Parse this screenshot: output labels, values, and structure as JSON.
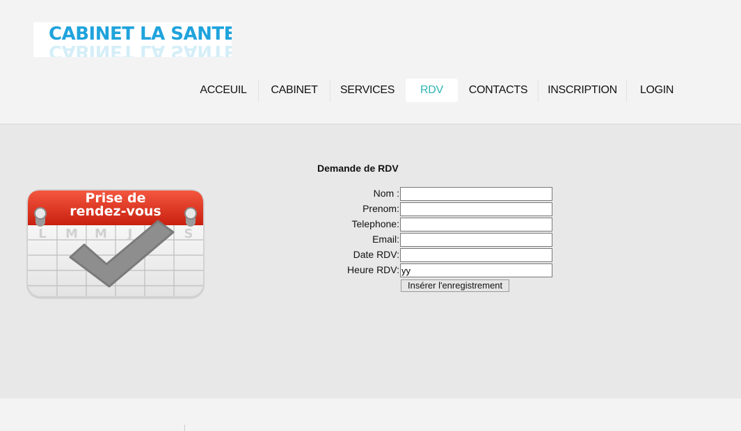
{
  "logo": {
    "text": "CABINET LA SANTE"
  },
  "nav": {
    "items": [
      {
        "label": "ACCEUIL"
      },
      {
        "label": "CABINET"
      },
      {
        "label": "SERVICES"
      },
      {
        "label": "RDV",
        "active": true
      },
      {
        "label": "CONTACTS"
      },
      {
        "label": "INSCRIPTION"
      },
      {
        "label": "LOGIN"
      }
    ],
    "active_color": "#2fb3b6"
  },
  "image": {
    "line1": "Prise de",
    "line2": "rendez-vous",
    "days": [
      "L",
      "M",
      "M",
      "J",
      "V",
      "S"
    ],
    "icons": [
      "calendar-icon",
      "checkmark-icon"
    ]
  },
  "form": {
    "title": "Demande de RDV",
    "fields": [
      {
        "label": "Nom :",
        "value": ""
      },
      {
        "label": "Prenom:",
        "value": ""
      },
      {
        "label": "Telephone:",
        "value": ""
      },
      {
        "label": "Email:",
        "value": ""
      },
      {
        "label": "Date RDV:",
        "value": ""
      },
      {
        "label": "Heure RDV:",
        "value": "yy"
      }
    ],
    "submit_label": "Insérer l'enregistrement"
  }
}
